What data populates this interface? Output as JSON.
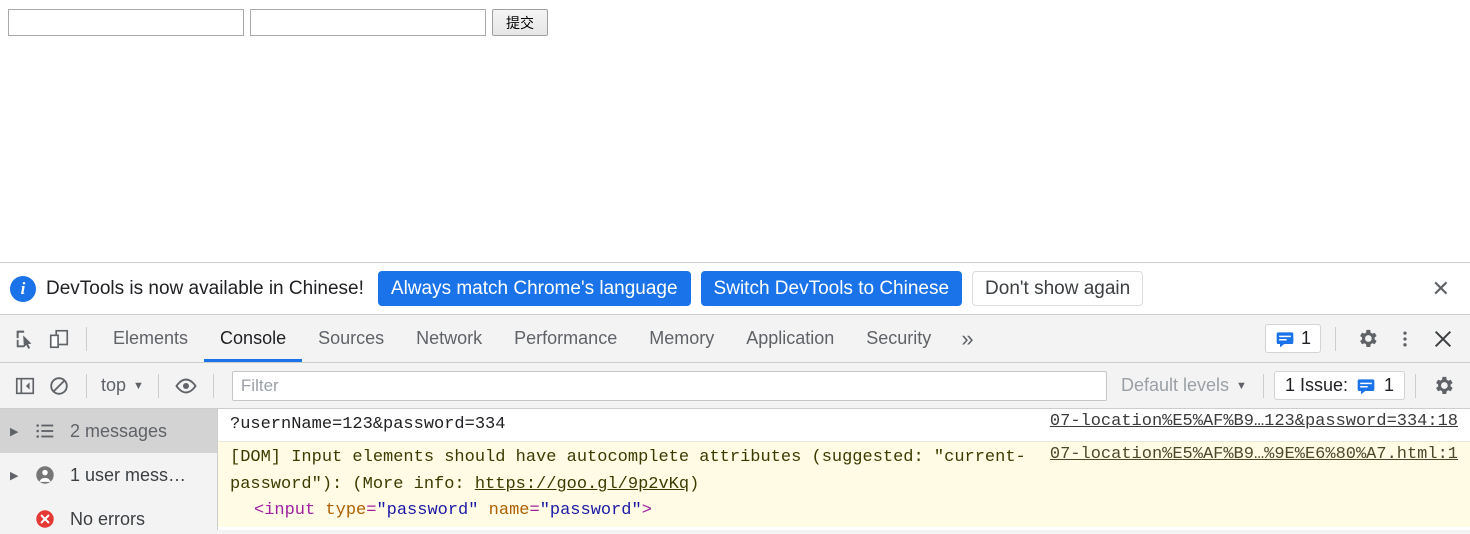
{
  "page": {
    "username_input": {
      "value": "",
      "placeholder": ""
    },
    "password_input": {
      "value": "",
      "placeholder": ""
    },
    "submit_button_label": "提交"
  },
  "banner": {
    "icon": "info-icon",
    "message": "DevTools is now available in Chinese!",
    "buttons": [
      {
        "label": "Always match Chrome's language",
        "style": "primary"
      },
      {
        "label": "Switch DevTools to Chinese",
        "style": "primary"
      },
      {
        "label": "Don't show again",
        "style": "outline"
      }
    ],
    "close_icon": "close-icon",
    "close_glyph": "✕",
    "accent_color": "#1a73e8"
  },
  "tabstrip": {
    "inspect_icon": "inspect-element-icon",
    "device_icon": "device-toolbar-icon",
    "tabs": [
      {
        "label": "Elements",
        "active": false
      },
      {
        "label": "Console",
        "active": true
      },
      {
        "label": "Sources",
        "active": false
      },
      {
        "label": "Network",
        "active": false
      },
      {
        "label": "Performance",
        "active": false
      },
      {
        "label": "Memory",
        "active": false
      },
      {
        "label": "Application",
        "active": false
      },
      {
        "label": "Security",
        "active": false
      }
    ],
    "more_tabs_glyph": "»",
    "issues_count": "1",
    "settings_icon": "gear-icon",
    "menu_icon": "kebab-menu-icon",
    "close_icon": "close-icon",
    "close_glyph": "✕",
    "active_tab_underline_color": "#1a73e8"
  },
  "console_toolbar": {
    "sidebar_toggle_icon": "console-sidebar-toggle-icon",
    "clear_icon": "clear-console-icon",
    "context_label": "top",
    "context_caret": "▼",
    "eye_icon": "live-expression-icon",
    "filter_placeholder": "Filter",
    "filter_value": "",
    "levels_label": "Default levels",
    "levels_caret": "▼",
    "issue_label": "1 Issue:",
    "issue_count": "1",
    "settings_icon": "gear-icon"
  },
  "console_sidebar": {
    "items": [
      {
        "label": "2 messages",
        "icon": "list-icon",
        "selected": true,
        "expandable": true
      },
      {
        "label": "1 user mess…",
        "icon": "user-icon",
        "selected": false,
        "expandable": true
      },
      {
        "label": "No errors",
        "icon": "error-circle-icon",
        "selected": false,
        "expandable": false
      }
    ]
  },
  "console_messages": [
    {
      "type": "log",
      "text": "?usernName=123&password=334",
      "source_link": "07-location%E5%AF%B9…123&password=334:18"
    },
    {
      "type": "warning",
      "text_part1": "[DOM] Input elements should have autocomplete attributes (suggested: \"current-password\"): (More info: ",
      "inline_link": "https://goo.gl/9p2vKq",
      "text_part2": ")",
      "source_link": "07-location%E5%AF%B9…%9E%E6%80%A7.html:1",
      "snippet": {
        "tag_open": "<input",
        "attr1_name": " type",
        "attr1_eq": "=",
        "attr1_value": "\"password\"",
        "attr2_name": " name",
        "attr2_eq": "=",
        "attr2_value": "\"password\"",
        "tag_close": ">"
      }
    }
  ]
}
